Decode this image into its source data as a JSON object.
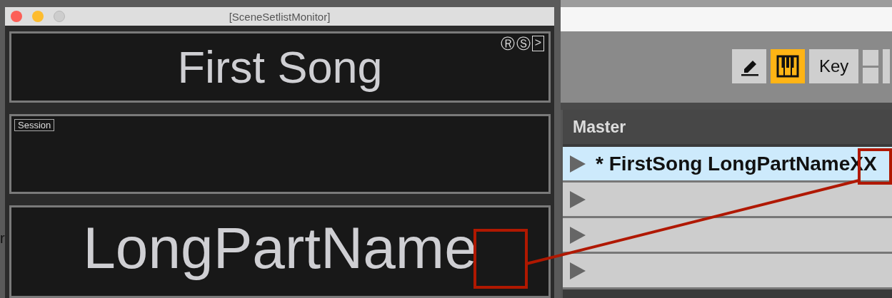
{
  "background_fragment": "r",
  "live": {
    "toolbar": [
      {
        "kind": "pencil",
        "on": false
      },
      {
        "kind": "piano",
        "on": true
      },
      {
        "kind": "text",
        "label": "Key",
        "on": false
      },
      {
        "kind": "split",
        "on": false
      },
      {
        "kind": "blank",
        "on": false
      }
    ],
    "track_header": "Master",
    "rows": [
      {
        "text": "* FirstSong LongPartNameXX",
        "selected": true
      },
      {
        "selected": false
      },
      {
        "selected": false
      },
      {
        "selected": false
      }
    ]
  },
  "monitor": {
    "window": {
      "title": "[SceneSetlistMonitor]"
    },
    "window_buttons": [
      {
        "kind": "close",
        "disabled": false
      },
      {
        "kind": "minimize",
        "disabled": false
      },
      {
        "kind": "zoom",
        "disabled": true
      }
    ],
    "song": "First Song",
    "badges": [
      "Ⓡ",
      "Ⓢ",
      ">"
    ],
    "mode_tag": "Session",
    "part": "LongPartName"
  },
  "callout_visible": true
}
